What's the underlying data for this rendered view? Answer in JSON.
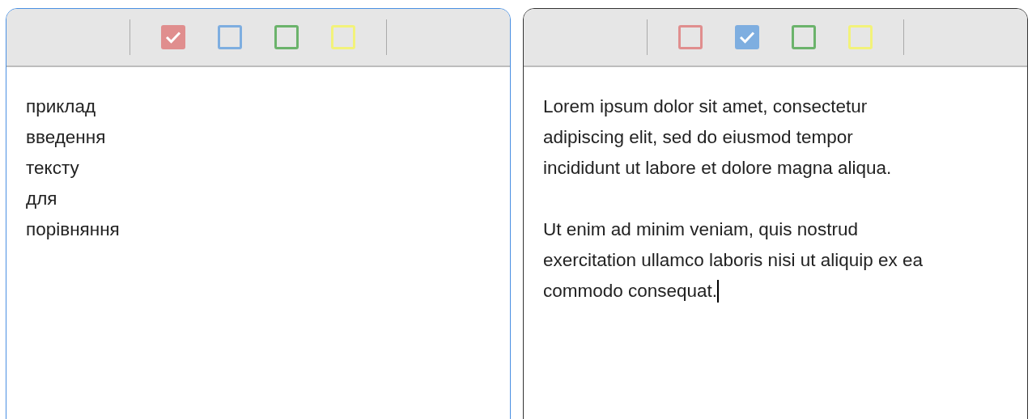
{
  "editors": [
    {
      "focused": true,
      "caret": false,
      "toolbar": [
        {
          "color": "#e08e8e",
          "checked": true
        },
        {
          "color": "#7eaee0",
          "checked": false
        },
        {
          "color": "#6bb36b",
          "checked": false
        },
        {
          "color": "#f2f27a",
          "checked": false
        }
      ],
      "paragraphs": [
        {
          "lines": [
            "приклад",
            "введення",
            "тексту",
            "для",
            "порівняння"
          ]
        }
      ]
    },
    {
      "focused": false,
      "caret": true,
      "toolbar": [
        {
          "color": "#e08e8e",
          "checked": false
        },
        {
          "color": "#7eaee0",
          "checked": true
        },
        {
          "color": "#6bb36b",
          "checked": false
        },
        {
          "color": "#f2f27a",
          "checked": false
        }
      ],
      "paragraphs": [
        {
          "lines": [
            "Lorem ipsum dolor sit amet, consectetur",
            "adipiscing elit, sed do eiusmod tempor",
            "incididunt ut labore et dolore magna aliqua."
          ]
        },
        {
          "lines": [
            "Ut enim ad minim veniam, quis nostrud",
            "exercitation ullamco laboris nisi ut aliquip ex ea",
            "commodo consequat."
          ]
        }
      ]
    }
  ]
}
